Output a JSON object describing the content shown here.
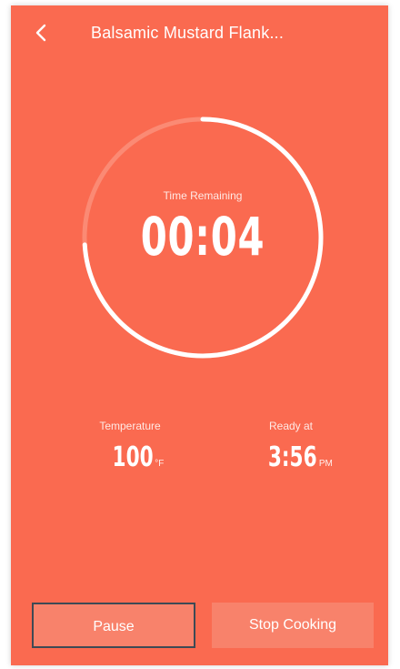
{
  "header": {
    "title": "Balsamic Mustard Flank...",
    "back_icon": "chevron-left-icon"
  },
  "timer": {
    "label": "Time Remaining",
    "value": "00:04",
    "progress_remaining": 0.74
  },
  "stats": {
    "temperature": {
      "label": "Temperature",
      "value": "100",
      "unit": "°F"
    },
    "ready": {
      "label": "Ready at",
      "value": "3:56",
      "unit": "PM"
    }
  },
  "actions": {
    "pause_label": "Pause",
    "stop_label": "Stop Cooking"
  },
  "colors": {
    "background": "#fa6a50",
    "button": "#f8826b",
    "focus_border": "#3d4a55",
    "ring_track": "#fb8a74",
    "ring_progress": "#ffffff"
  }
}
